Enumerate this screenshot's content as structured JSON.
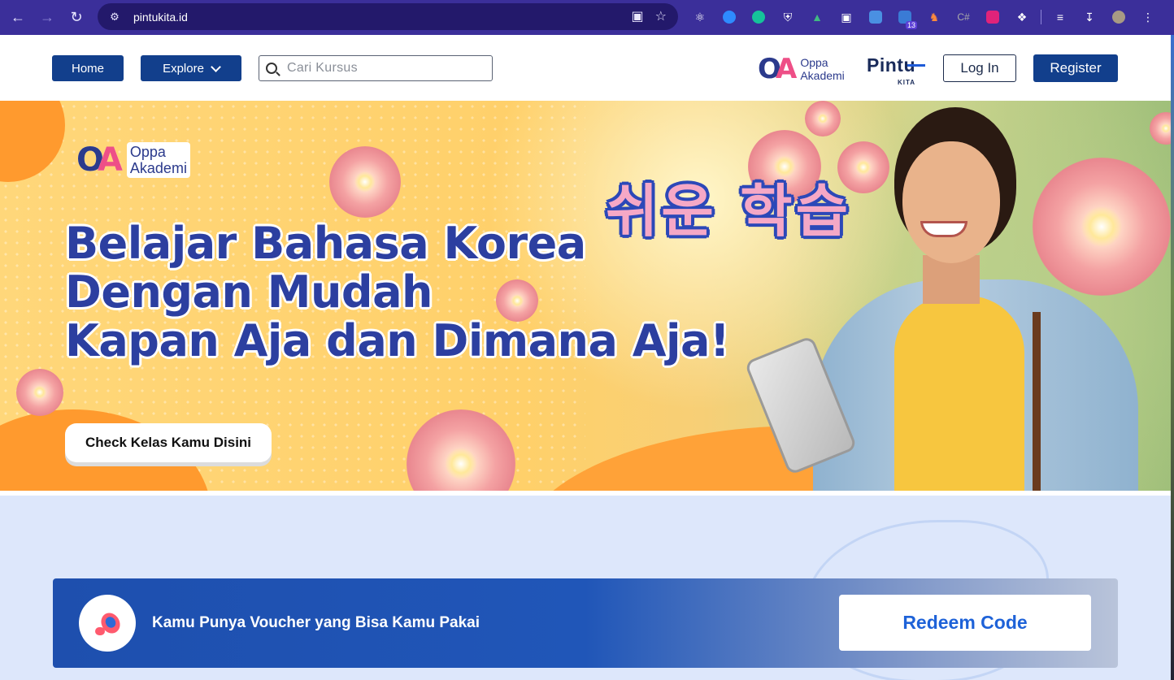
{
  "browser": {
    "url": "pintukita.id",
    "extension_badge": "13",
    "icons": [
      "back-icon",
      "forward-icon",
      "reload-icon",
      "site-settings-icon",
      "install-app-icon",
      "bookmark-star-icon",
      "react-devtools-icon",
      "extension-icon",
      "grammarly-icon",
      "shield-icon",
      "vue-devtools-icon",
      "window-icon",
      "doc-icon",
      "tab-counter-icon",
      "chess-icon",
      "css-icon",
      "gem-icon",
      "puzzle-icon",
      "reading-list-icon",
      "download-icon",
      "profile-avatar",
      "menu-kebab-icon"
    ]
  },
  "header": {
    "home_label": "Home",
    "explore_label": "Explore",
    "search_placeholder": "Cari Kursus",
    "oa_logo_line1": "Oppa",
    "oa_logo_line2": "Akademi",
    "pintu_logo": "Pintu",
    "pintu_sub": "KITA",
    "login_label": "Log In",
    "register_label": "Register"
  },
  "banner": {
    "logo_line1": "Oppa",
    "logo_line2": "Akademi",
    "headline_1": "Belajar Bahasa Korea",
    "headline_2": "Dengan Mudah",
    "headline_3": "Kapan Aja dan Dimana Aja!",
    "korean_text": "쉬운 학습",
    "cta_label": "Check Kelas Kamu Disini"
  },
  "voucher": {
    "message": "Kamu Punya Voucher yang Bisa Kamu Pakai",
    "button_label": "Redeem Code"
  },
  "colors": {
    "brand_navy": "#123f8c",
    "banner_blue": "#2c3fa0",
    "accent_pink": "#ee4f87",
    "voucher_blue": "#1e4fae",
    "redeem_text": "#1e62d8"
  }
}
